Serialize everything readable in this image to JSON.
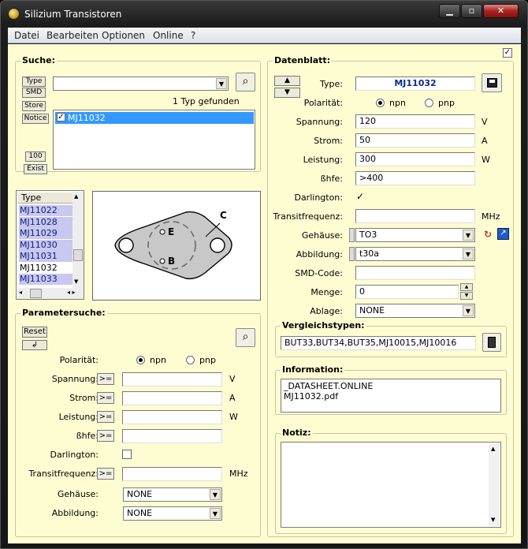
{
  "window": {
    "title": "Silizium Transistoren"
  },
  "menu": [
    "Datei",
    "Bearbeiten",
    "Optionen",
    "Online",
    "?"
  ],
  "suche": {
    "title": "Suche:",
    "buttons": [
      "Type",
      "SMD",
      "Store",
      "Notice"
    ],
    "count_button": "100",
    "exist_button": "Exist",
    "search_value": "",
    "result_text": "1 Typ gefunden",
    "results": [
      {
        "label": "MJ11032",
        "checked": true
      }
    ]
  },
  "typelist": {
    "header": "Type",
    "items": [
      "MJ11022",
      "MJ11028",
      "MJ11029",
      "MJ11030",
      "MJ11031",
      "MJ11032",
      "MJ11033"
    ]
  },
  "package_labels": {
    "e": "E",
    "b": "B",
    "c": "C"
  },
  "parametersuche": {
    "title": "Parametersuche:",
    "reset": "Reset",
    "back": "↲",
    "polaritaet_label": "Polarität:",
    "npn": "npn",
    "pnp": "pnp",
    "rows": [
      {
        "label": "Spannung:",
        "op": ">=",
        "unit": "V"
      },
      {
        "label": "Strom:",
        "op": ">=",
        "unit": "A"
      },
      {
        "label": "Leistung:",
        "op": ">=",
        "unit": "W"
      },
      {
        "label": "ßhfe:",
        "op": ">=",
        "unit": ""
      },
      {
        "label": "Darlington:",
        "op": "",
        "unit": ""
      },
      {
        "label": "Transitfrequenz:",
        "op": ">=",
        "unit": "MHz"
      }
    ],
    "gehaeuse_label": "Gehäuse:",
    "gehaeuse_value": "NONE",
    "abbildung_label": "Abbildung:",
    "abbildung_value": "NONE"
  },
  "datenblatt": {
    "title": "Datenblatt:",
    "type_label": "Type:",
    "type_value": "MJ11032",
    "polaritaet_label": "Polarität:",
    "npn": "npn",
    "pnp": "pnp",
    "spannung_label": "Spannung:",
    "spannung_value": "120",
    "spannung_unit": "V",
    "strom_label": "Strom:",
    "strom_value": "50",
    "strom_unit": "A",
    "leistung_label": "Leistung:",
    "leistung_value": "300",
    "leistung_unit": "W",
    "hfe_label": "ßhfe:",
    "hfe_value": ">400",
    "darlington_label": "Darlington:",
    "transit_label": "Transitfrequenz:",
    "transit_value": "",
    "transit_unit": "MHz",
    "gehaeuse_label": "Gehäuse:",
    "gehaeuse_value": "TO3",
    "abbildung_label": "Abbildung:",
    "abbildung_value": "t30a",
    "smd_label": "SMD-Code:",
    "smd_value": "",
    "menge_label": "Menge:",
    "menge_value": "0",
    "ablage_label": "Ablage:",
    "ablage_value": "NONE"
  },
  "vergleich": {
    "title": "Vergleichstypen:",
    "value": "BUT33,BUT34,BUT35,MJ10015,MJ10016"
  },
  "information": {
    "title": "Information:",
    "lines": [
      "_DATASHEET.ONLINE",
      "MJ11032.pdf"
    ]
  },
  "notiz": {
    "title": "Notiz:",
    "value": ""
  }
}
